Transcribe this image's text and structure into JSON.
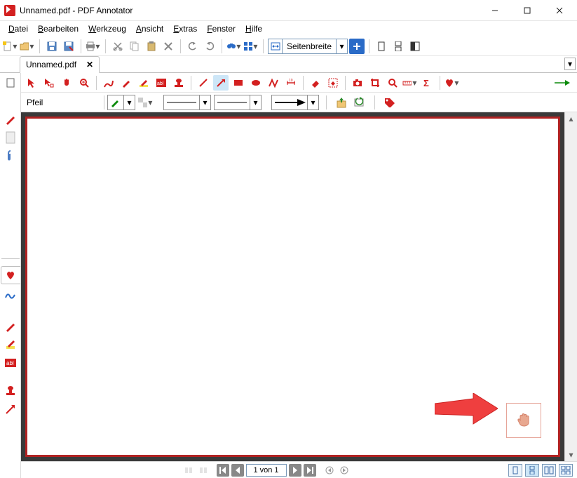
{
  "window": {
    "title": "Unnamed.pdf - PDF Annotator"
  },
  "menu": {
    "file": "Datei",
    "edit": "Bearbeiten",
    "tool": "Werkzeug",
    "view": "Ansicht",
    "extras": "Extras",
    "window": "Fenster",
    "help": "Hilfe"
  },
  "zoom": {
    "value": "Seitenbreite"
  },
  "tab": {
    "name": "Unnamed.pdf"
  },
  "tool": {
    "current": "Pfeil"
  },
  "status": {
    "page_display": "1 von 1"
  }
}
